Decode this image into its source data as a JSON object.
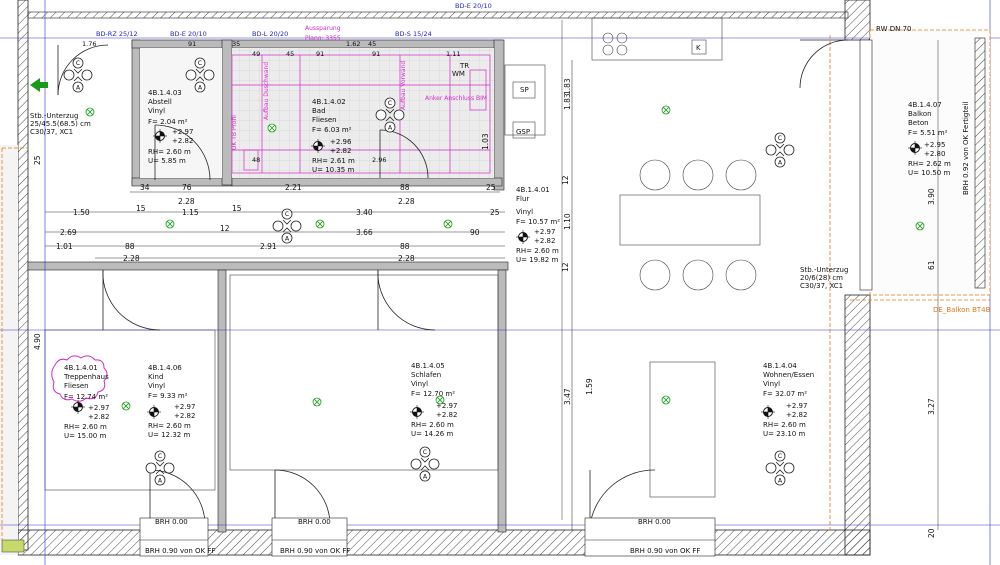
{
  "rooms": {
    "abstell": {
      "id": "4B.1.4.03",
      "name": "Abstell",
      "floor": "Vinyl",
      "area": "F= 2.04 m²",
      "lvl1": "+2.97",
      "lvl2": "+2.82",
      "rh": "RH= 2.60 m",
      "u": "U= 5.85 m"
    },
    "bad": {
      "id": "4B.1.4.02",
      "name": "Bad",
      "floor": "Fliesen",
      "area": "F= 6.03 m²",
      "lvl1": "+2.96",
      "lvl2": "+2.82",
      "rh": "RH= 2.61 m",
      "u": "U= 10.35 m"
    },
    "flur": {
      "id": "4B.1.4.01",
      "name": "Flur",
      "floor": "Vinyl",
      "area": "F= 10.57 m²",
      "lvl1": "+2.97",
      "lvl2": "+2.82",
      "rh": "RH= 2.60 m",
      "u": "U= 19.82 m"
    },
    "balkon": {
      "id": "4B.1.4.07",
      "name": "Balkon",
      "floor": "Beton",
      "area": "F= 5.51 m²",
      "lvl1": "+2.95",
      "lvl2": "+2.80",
      "rh": "RH= 2.62 m",
      "u": "U= 10.50 m"
    },
    "treppenhaus": {
      "id": "4B.1.4.01",
      "name": "Treppenhaus",
      "floor": "Fliesen",
      "area": "F= 12.74 m²",
      "lvl1": "+2.97",
      "lvl2": "+2.82",
      "rh": "RH= 2.60 m",
      "u": "U= 15.00 m"
    },
    "kind": {
      "id": "4B.1.4.06",
      "name": "Kind",
      "floor": "Vinyl",
      "area": "F= 9.33 m²",
      "lvl1": "+2.97",
      "lvl2": "+2.82",
      "rh": "RH= 2.60 m",
      "u": "U= 12.32 m"
    },
    "schlafen": {
      "id": "4B.1.4.05",
      "name": "Schlafen",
      "floor": "Vinyl",
      "area": "F= 12.70 m²",
      "lvl1": "+2.97",
      "lvl2": "+2.82",
      "rh": "RH= 2.60 m",
      "u": "U= 14.26 m"
    },
    "wohnen": {
      "id": "4B.1.4.04",
      "name": "Wohnen/Essen",
      "floor": "Vinyl",
      "area": "F= 32.07 m²",
      "lvl1": "+2.97",
      "lvl2": "+2.82",
      "rh": "RH= 2.60 m",
      "u": "U= 23.10 m"
    }
  },
  "labels": {
    "stb_left_1": "Stb.-Unterzug",
    "stb_left_2": "25/45.5(68.5) cm",
    "stb_left_3": "C30/37, XC1",
    "stb_right_1": "Stb.-Unterzug",
    "stb_right_2": "20/6(28) cm",
    "stb_right_3": "C30/37, XC1",
    "balkon_tag": "DE_Balkon BT4B",
    "brh_balkon": "BRH 0.92 von OK Fertigteil",
    "rw": "RW DN 70",
    "sp": "SP",
    "gsp": "GSP",
    "wm": "WM",
    "k": "K",
    "tr": "TR",
    "top_tags": [
      "BD-RZ 25/12",
      "BD-E 20/10",
      "BD-L 20/20",
      "BD-S 15/24",
      "BD-E 20/10"
    ],
    "brh_sill": [
      "BRH 0.00",
      "BRH 0.00",
      "BRH 0.00"
    ],
    "brh_bottom": [
      "BRH 0.90 von OK FF",
      "BRH 0.90 von OK FF",
      "BRH 0.90 von OK FF"
    ],
    "pink_notes": [
      "Aufbau Duschwand",
      "Aufbau Vorwand",
      "Anker Anschluss BIM",
      "UK TB Profil",
      "Plano: 3355",
      "Aussparung"
    ]
  },
  "dims": {
    "row1": [
      "34",
      "76",
      "2.21",
      "88",
      "25"
    ],
    "row2": [
      "2.28",
      "2.28"
    ],
    "row3": [
      "1.50",
      "15",
      "1.15",
      "15",
      "3.40",
      "25"
    ],
    "row4": [
      "2.69",
      "12",
      "3.66",
      "90"
    ],
    "row5": [
      "1.01",
      "88",
      "2.91",
      "88"
    ],
    "row6": [
      "2.28",
      "2.28"
    ],
    "top_small": [
      "1.76",
      "35",
      "91",
      "45",
      "49",
      "91",
      "1.11",
      "48",
      "2.96",
      "1.62",
      "45",
      "91"
    ],
    "vertical": [
      "4.90",
      "3.47",
      "1.59",
      "1.10",
      "1.83",
      "12",
      "12",
      "3.90",
      "61",
      "3.27",
      "20",
      "25",
      "1.83",
      "1.03"
    ]
  }
}
